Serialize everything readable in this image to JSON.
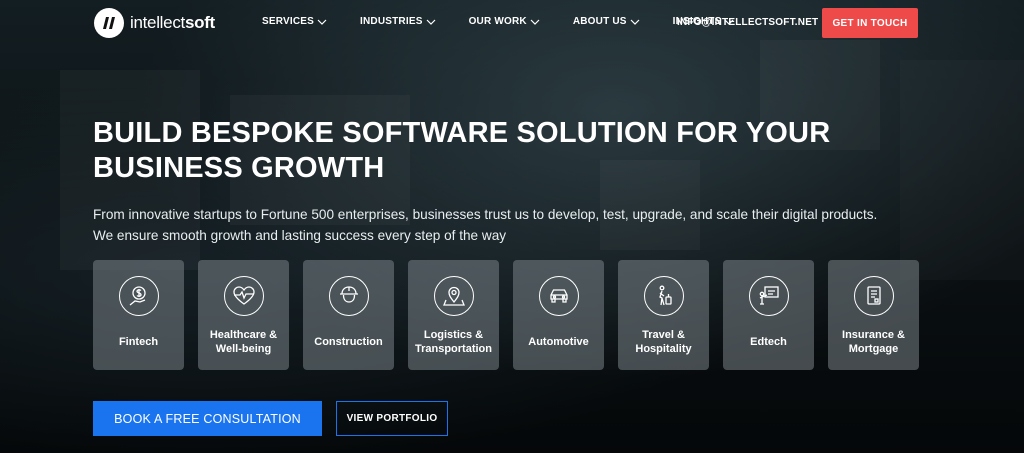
{
  "brand": {
    "logo_mark": "IS",
    "name_light": "intellect",
    "name_bold": "soft"
  },
  "nav": {
    "items": [
      {
        "label": "SERVICES"
      },
      {
        "label": "INDUSTRIES"
      },
      {
        "label": "OUR WORK"
      },
      {
        "label": "ABOUT US"
      },
      {
        "label": "INSIGHTS"
      }
    ],
    "email": "INFO@INTELLECTSOFT.NET",
    "cta_label": "GET IN TOUCH"
  },
  "hero": {
    "title_line1": "BUILD BESPOKE SOFTWARE SOLUTION FOR YOUR",
    "title_line2": "BUSINESS GROWTH",
    "subtitle_line1": "From innovative startups to Fortune 500 enterprises, businesses trust us to develop, test, upgrade, and scale their digital products.",
    "subtitle_line2": "We ensure smooth growth and lasting success every step of the way"
  },
  "industries": [
    {
      "icon": "dollar-hand-icon",
      "line1": "Fintech",
      "line2": ""
    },
    {
      "icon": "heart-pulse-icon",
      "line1": "Healthcare &",
      "line2": "Well-being"
    },
    {
      "icon": "hard-hat-worker-icon",
      "line1": "Construction",
      "line2": ""
    },
    {
      "icon": "map-pin-icon",
      "line1": "Logistics &",
      "line2": "Transportation"
    },
    {
      "icon": "car-icon",
      "line1": "Automotive",
      "line2": ""
    },
    {
      "icon": "traveler-luggage-icon",
      "line1": "Travel &",
      "line2": "Hospitality"
    },
    {
      "icon": "teacher-board-icon",
      "line1": "Edtech",
      "line2": ""
    },
    {
      "icon": "document-policy-icon",
      "line1": "Insurance &",
      "line2": "Mortgage"
    }
  ],
  "buttons": {
    "primary_label": "BOOK A FREE CONSULTATION",
    "secondary_label": "VIEW PORTFOLIO"
  },
  "colors": {
    "cta_red": "#ef4a4a",
    "primary_blue": "#1a74f0",
    "card_bg": "rgba(120,130,135,0.55)"
  }
}
